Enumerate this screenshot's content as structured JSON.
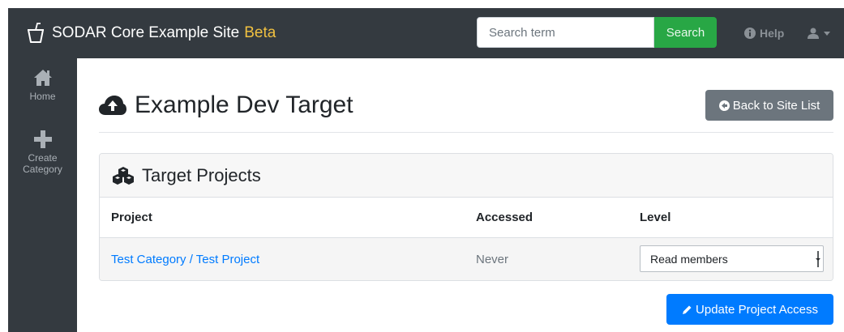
{
  "navbar": {
    "brand_icon": "cup-icon",
    "site_name": "SODAR Core Example Site",
    "site_badge": "Beta",
    "search": {
      "placeholder": "Search term",
      "button_label": "Search"
    },
    "help": {
      "icon": "info-circle-icon",
      "label": "Help"
    },
    "user_menu": {
      "icon": "user-icon",
      "caret": "caret-down-icon"
    }
  },
  "sidebar": {
    "items": [
      {
        "icon": "home-icon",
        "label": "Home"
      },
      {
        "icon": "plus-icon",
        "label": "Create Category"
      }
    ]
  },
  "main": {
    "title_icon": "cloud-upload-icon",
    "title": "Example Dev Target",
    "back_button": {
      "icon": "arrow-circle-left-icon",
      "label": "Back to Site List"
    },
    "card": {
      "icon": "cubes-icon",
      "title": "Target Projects",
      "columns": [
        "Project",
        "Accessed",
        "Level"
      ],
      "rows": [
        {
          "project": "Test Category / Test Project",
          "accessed": "Never",
          "level": "Read members"
        }
      ]
    },
    "update_button": {
      "icon": "pencil-icon",
      "label": "Update Project Access"
    }
  },
  "colors": {
    "navbar_bg": "#343a40",
    "badge": "#f0c040",
    "search_button": "#28a745",
    "primary": "#007bff",
    "secondary": "#6c757d"
  }
}
